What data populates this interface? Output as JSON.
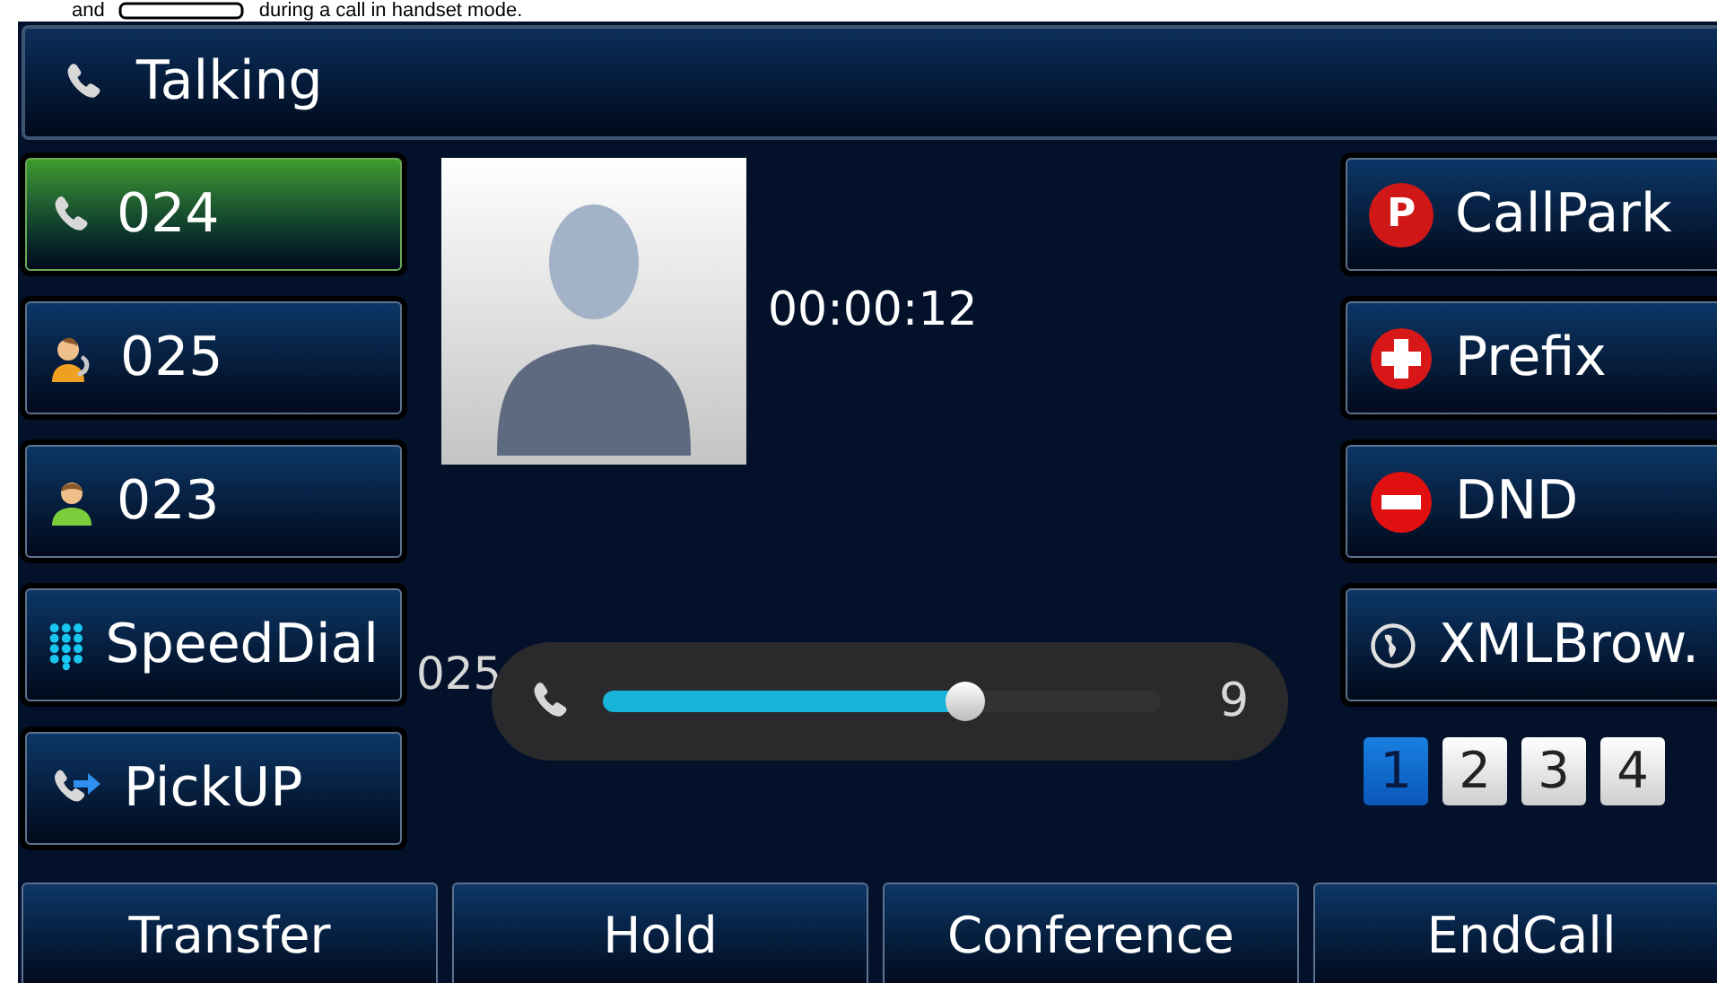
{
  "document_text": {
    "before": "and",
    "after": "during a call in handset mode."
  },
  "title_bar": {
    "title": "Talking"
  },
  "line_keys": [
    {
      "label": "024",
      "kind": "line",
      "selected": true
    },
    {
      "label": "025",
      "kind": "contact-talking",
      "selected": false
    },
    {
      "label": "023",
      "kind": "contact",
      "selected": false
    },
    {
      "label": "SpeedDial",
      "kind": "speeddial",
      "selected": false
    },
    {
      "label": "PickUP",
      "kind": "pickup",
      "selected": false
    }
  ],
  "call": {
    "duration": "00:00:12"
  },
  "dialed_number": "025",
  "volume": {
    "level": 0.65,
    "reading": "9"
  },
  "function_keys": [
    {
      "label": "CallPark",
      "kind": "callpark",
      "icon_letter": "P"
    },
    {
      "label": "Prefix",
      "kind": "prefix"
    },
    {
      "label": "DND",
      "kind": "dnd"
    },
    {
      "label": "XMLBrow.",
      "kind": "xmlbrowser"
    }
  ],
  "pages": [
    {
      "label": "1",
      "selected": true
    },
    {
      "label": "2",
      "selected": false
    },
    {
      "label": "3",
      "selected": false
    },
    {
      "label": "4",
      "selected": false
    }
  ],
  "softkeys": [
    "Transfer",
    "Hold",
    "Conference",
    "EndCall"
  ]
}
